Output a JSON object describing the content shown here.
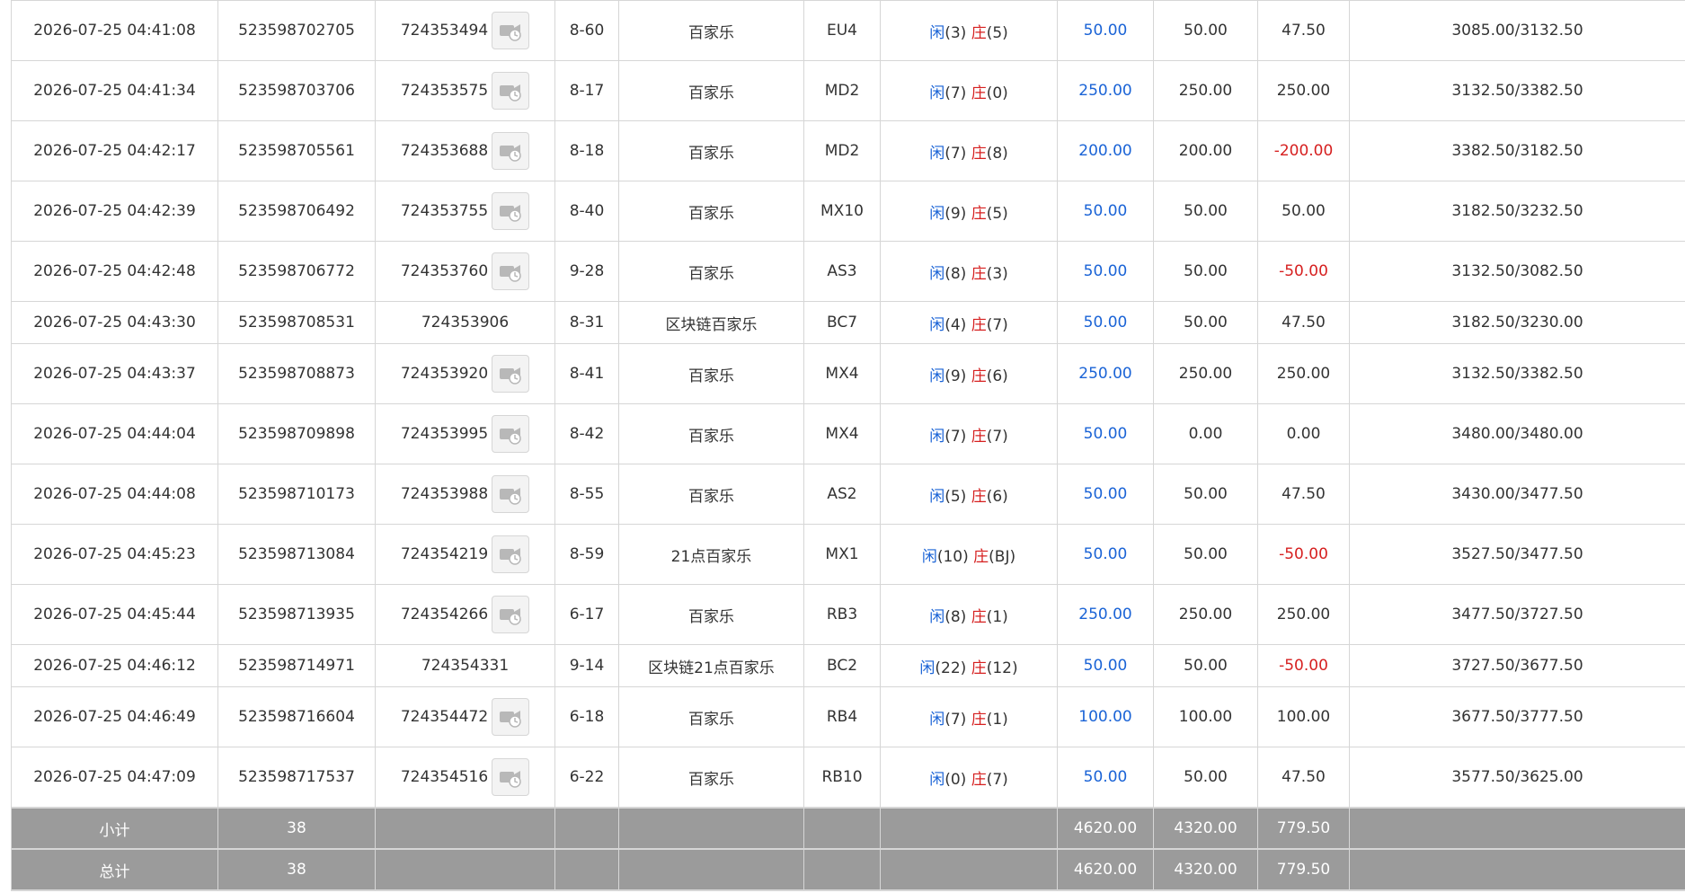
{
  "rows": [
    {
      "time": "2026-07-25 04:41:08",
      "order_no": "523598702705",
      "round_no": "724353494",
      "has_video": true,
      "shoe": "8-60",
      "game": "百家乐",
      "table": "EU4",
      "xian_label": "闲",
      "xian_val": "(3)",
      "zhuang_label": "庄",
      "zhuang_val": "(5)",
      "bet": "50.00",
      "valid_bet": "50.00",
      "payout": "47.50",
      "payout_negative": false,
      "balance": "3085.00/3132.50"
    },
    {
      "time": "2026-07-25 04:41:34",
      "order_no": "523598703706",
      "round_no": "724353575",
      "has_video": true,
      "shoe": "8-17",
      "game": "百家乐",
      "table": "MD2",
      "xian_label": "闲",
      "xian_val": "(7)",
      "zhuang_label": "庄",
      "zhuang_val": "(0)",
      "bet": "250.00",
      "valid_bet": "250.00",
      "payout": "250.00",
      "payout_negative": false,
      "balance": "3132.50/3382.50"
    },
    {
      "time": "2026-07-25 04:42:17",
      "order_no": "523598705561",
      "round_no": "724353688",
      "has_video": true,
      "shoe": "8-18",
      "game": "百家乐",
      "table": "MD2",
      "xian_label": "闲",
      "xian_val": "(7)",
      "zhuang_label": "庄",
      "zhuang_val": "(8)",
      "bet": "200.00",
      "valid_bet": "200.00",
      "payout": "-200.00",
      "payout_negative": true,
      "balance": "3382.50/3182.50"
    },
    {
      "time": "2026-07-25 04:42:39",
      "order_no": "523598706492",
      "round_no": "724353755",
      "has_video": true,
      "shoe": "8-40",
      "game": "百家乐",
      "table": "MX10",
      "xian_label": "闲",
      "xian_val": "(9)",
      "zhuang_label": "庄",
      "zhuang_val": "(5)",
      "bet": "50.00",
      "valid_bet": "50.00",
      "payout": "50.00",
      "payout_negative": false,
      "balance": "3182.50/3232.50"
    },
    {
      "time": "2026-07-25 04:42:48",
      "order_no": "523598706772",
      "round_no": "724353760",
      "has_video": true,
      "shoe": "9-28",
      "game": "百家乐",
      "table": "AS3",
      "xian_label": "闲",
      "xian_val": "(8)",
      "zhuang_label": "庄",
      "zhuang_val": "(3)",
      "bet": "50.00",
      "valid_bet": "50.00",
      "payout": "-50.00",
      "payout_negative": true,
      "balance": "3132.50/3082.50"
    },
    {
      "time": "2026-07-25 04:43:30",
      "order_no": "523598708531",
      "round_no": "724353906",
      "has_video": false,
      "shoe": "8-31",
      "game": "区块链百家乐",
      "table": "BC7",
      "xian_label": "闲",
      "xian_val": "(4)",
      "zhuang_label": "庄",
      "zhuang_val": "(7)",
      "bet": "50.00",
      "valid_bet": "50.00",
      "payout": "47.50",
      "payout_negative": false,
      "balance": "3182.50/3230.00"
    },
    {
      "time": "2026-07-25 04:43:37",
      "order_no": "523598708873",
      "round_no": "724353920",
      "has_video": true,
      "shoe": "8-41",
      "game": "百家乐",
      "table": "MX4",
      "xian_label": "闲",
      "xian_val": "(9)",
      "zhuang_label": "庄",
      "zhuang_val": "(6)",
      "bet": "250.00",
      "valid_bet": "250.00",
      "payout": "250.00",
      "payout_negative": false,
      "balance": "3132.50/3382.50"
    },
    {
      "time": "2026-07-25 04:44:04",
      "order_no": "523598709898",
      "round_no": "724353995",
      "has_video": true,
      "shoe": "8-42",
      "game": "百家乐",
      "table": "MX4",
      "xian_label": "闲",
      "xian_val": "(7)",
      "zhuang_label": "庄",
      "zhuang_val": "(7)",
      "bet": "50.00",
      "valid_bet": "0.00",
      "payout": "0.00",
      "payout_negative": false,
      "balance": "3480.00/3480.00"
    },
    {
      "time": "2026-07-25 04:44:08",
      "order_no": "523598710173",
      "round_no": "724353988",
      "has_video": true,
      "shoe": "8-55",
      "game": "百家乐",
      "table": "AS2",
      "xian_label": "闲",
      "xian_val": "(5)",
      "zhuang_label": "庄",
      "zhuang_val": "(6)",
      "bet": "50.00",
      "valid_bet": "50.00",
      "payout": "47.50",
      "payout_negative": false,
      "balance": "3430.00/3477.50"
    },
    {
      "time": "2026-07-25 04:45:23",
      "order_no": "523598713084",
      "round_no": "724354219",
      "has_video": true,
      "shoe": "8-59",
      "game": "21点百家乐",
      "table": "MX1",
      "xian_label": "闲",
      "xian_val": "(10)",
      "zhuang_label": "庄",
      "zhuang_val": "(BJ)",
      "bet": "50.00",
      "valid_bet": "50.00",
      "payout": "-50.00",
      "payout_negative": true,
      "balance": "3527.50/3477.50"
    },
    {
      "time": "2026-07-25 04:45:44",
      "order_no": "523598713935",
      "round_no": "724354266",
      "has_video": true,
      "shoe": "6-17",
      "game": "百家乐",
      "table": "RB3",
      "xian_label": "闲",
      "xian_val": "(8)",
      "zhuang_label": "庄",
      "zhuang_val": "(1)",
      "bet": "250.00",
      "valid_bet": "250.00",
      "payout": "250.00",
      "payout_negative": false,
      "balance": "3477.50/3727.50"
    },
    {
      "time": "2026-07-25 04:46:12",
      "order_no": "523598714971",
      "round_no": "724354331",
      "has_video": false,
      "shoe": "9-14",
      "game": "区块链21点百家乐",
      "table": "BC2",
      "xian_label": "闲",
      "xian_val": "(22)",
      "zhuang_label": "庄",
      "zhuang_val": "(12)",
      "bet": "50.00",
      "valid_bet": "50.00",
      "payout": "-50.00",
      "payout_negative": true,
      "balance": "3727.50/3677.50"
    },
    {
      "time": "2026-07-25 04:46:49",
      "order_no": "523598716604",
      "round_no": "724354472",
      "has_video": true,
      "shoe": "6-18",
      "game": "百家乐",
      "table": "RB4",
      "xian_label": "闲",
      "xian_val": "(7)",
      "zhuang_label": "庄",
      "zhuang_val": "(1)",
      "bet": "100.00",
      "valid_bet": "100.00",
      "payout": "100.00",
      "payout_negative": false,
      "balance": "3677.50/3777.50"
    },
    {
      "time": "2026-07-25 04:47:09",
      "order_no": "523598717537",
      "round_no": "724354516",
      "has_video": true,
      "shoe": "6-22",
      "game": "百家乐",
      "table": "RB10",
      "xian_label": "闲",
      "xian_val": "(0)",
      "zhuang_label": "庄",
      "zhuang_val": "(7)",
      "bet": "50.00",
      "valid_bet": "50.00",
      "payout": "47.50",
      "payout_negative": false,
      "balance": "3577.50/3625.00"
    }
  ],
  "subtotal": {
    "label": "小计",
    "count": "38",
    "bet": "4620.00",
    "valid_bet": "4320.00",
    "payout": "779.50"
  },
  "total": {
    "label": "总计",
    "count": "38",
    "bet": "4620.00",
    "valid_bet": "4320.00",
    "payout": "779.50"
  },
  "colors": {
    "player": "#1a63d6",
    "banker": "#d62020",
    "summary_bg": "#9b9b9b",
    "border": "#d6d6d6"
  },
  "icons": {
    "video": "video-replay-icon"
  }
}
